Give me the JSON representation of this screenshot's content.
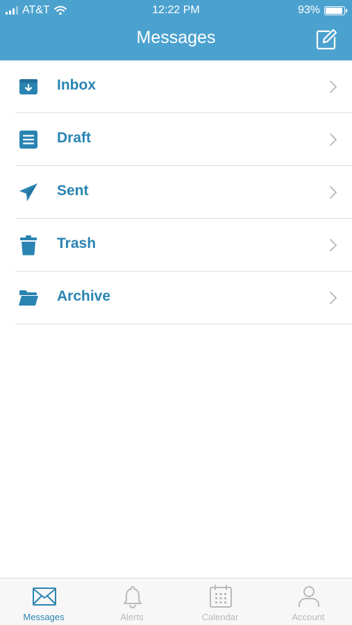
{
  "status_bar": {
    "carrier": "AT&T",
    "time": "12:22 PM",
    "battery": "93%",
    "battery_level": 0.93
  },
  "header": {
    "title": "Messages",
    "compose_icon": "compose-icon"
  },
  "folders": [
    {
      "label": "Inbox",
      "icon": "inbox-icon"
    },
    {
      "label": "Draft",
      "icon": "draft-icon"
    },
    {
      "label": "Sent",
      "icon": "sent-icon"
    },
    {
      "label": "Trash",
      "icon": "trash-icon"
    },
    {
      "label": "Archive",
      "icon": "archive-icon"
    }
  ],
  "tabs": [
    {
      "label": "Messages",
      "icon": "envelope-icon",
      "active": true
    },
    {
      "label": "Alerts",
      "icon": "bell-icon",
      "active": false
    },
    {
      "label": "Calendar",
      "icon": "calendar-icon",
      "active": false
    },
    {
      "label": "Account",
      "icon": "person-icon",
      "active": false
    }
  ],
  "colors": {
    "header": "#4ca2cf",
    "accent": "#2a84b2",
    "inactive": "#b9b9b9",
    "separator": "#dcdcdc"
  }
}
